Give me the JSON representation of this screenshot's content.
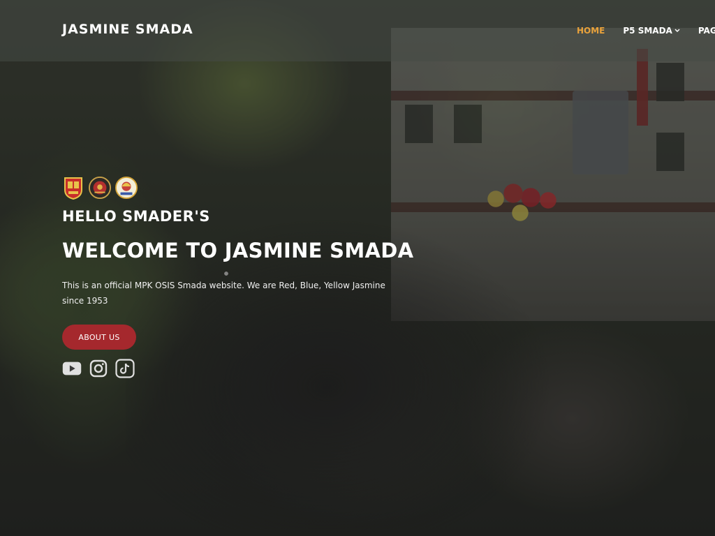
{
  "header": {
    "logo": "JASMINE SMADA",
    "nav": [
      {
        "label": "HOME",
        "active": true,
        "dropdown": false
      },
      {
        "label": "P5 SMADA",
        "active": false,
        "dropdown": true
      },
      {
        "label": "PAGES",
        "active": false,
        "dropdown": false
      }
    ]
  },
  "hero": {
    "badges": [
      "school-crest-icon",
      "osis-emblem-icon",
      "mpk-emblem-icon"
    ],
    "greeting": "HELLO SMADER'S",
    "title": "WELCOME TO JASMINE SMADA",
    "description": "This is an official MPK OSIS Smada website. We are Red, Blue, Yellow Jasmine since 1953",
    "button_label": "ABOUT US",
    "socials": [
      "youtube-icon",
      "instagram-icon",
      "tiktok-icon"
    ]
  },
  "colors": {
    "accent_active": "#e9a23b",
    "button_bg": "#a5282d"
  }
}
